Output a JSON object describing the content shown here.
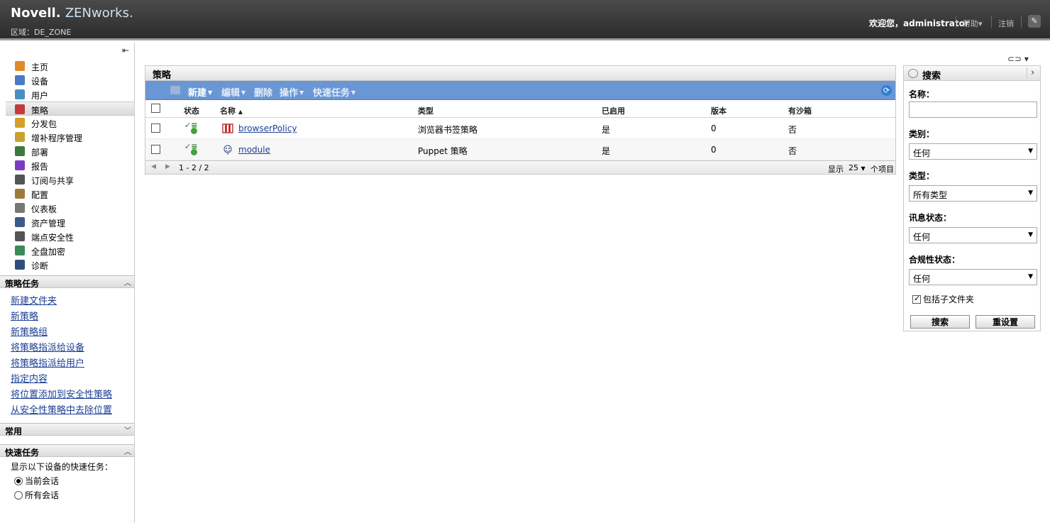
{
  "header": {
    "brand_novell": "Novell.",
    "brand_zen": "ZENworks.",
    "zone": "区域：DE_ZONE",
    "welcome": "欢迎您，administrator",
    "help": "帮助▾",
    "logout": "注销"
  },
  "nav": {
    "items": [
      {
        "label": "主页",
        "icon": "home-icon",
        "color": "#e08a2c"
      },
      {
        "label": "设备",
        "icon": "devices-icon",
        "color": "#4a7bc2"
      },
      {
        "label": "用户",
        "icon": "users-icon",
        "color": "#4a8fc2"
      },
      {
        "label": "策略",
        "icon": "policies-icon",
        "color": "#c23b3b"
      },
      {
        "label": "分发包",
        "icon": "bundles-icon",
        "color": "#d3a02a"
      },
      {
        "label": "增补程序管理",
        "icon": "patch-management-icon",
        "color": "#c9a131"
      },
      {
        "label": "部署",
        "icon": "deployment-icon",
        "color": "#3b7a3b"
      },
      {
        "label": "报告",
        "icon": "reports-icon",
        "color": "#7a3bc2"
      },
      {
        "label": "订阅与共享",
        "icon": "subscriptions-icon",
        "color": "#555555"
      },
      {
        "label": "配置",
        "icon": "configuration-icon",
        "color": "#a07a3b"
      },
      {
        "label": "仪表板",
        "icon": "dashboard-icon",
        "color": "#777777"
      },
      {
        "label": "资产管理",
        "icon": "asset-management-icon",
        "color": "#3b5a8a"
      },
      {
        "label": "端点安全性",
        "icon": "endpoint-security-icon",
        "color": "#555555"
      },
      {
        "label": "全盘加密",
        "icon": "full-disk-encryption-icon",
        "color": "#3b8a5a"
      },
      {
        "label": "诊断",
        "icon": "diagnostics-icon",
        "color": "#2f4f7a"
      }
    ],
    "active_index": 3
  },
  "policy_tasks": {
    "title": "策略任务",
    "links": [
      "新建文件夹",
      "新策略",
      "新策略组",
      "将策略指派给设备",
      "将策略指派给用户",
      "指定内容",
      "将位置添加到安全性策略",
      "从安全性策略中去除位置"
    ]
  },
  "common": {
    "title": "常用"
  },
  "quick_tasks": {
    "title": "快速任务",
    "text": "显示以下设备的快速任务：",
    "options": [
      "当前会话",
      "所有会话"
    ],
    "selected": 0
  },
  "main": {
    "title": "策略",
    "toolbar": {
      "new": "新建",
      "edit": "编辑",
      "delete": "删除",
      "actions": "操作",
      "quick_tasks": "快速任务"
    },
    "columns": [
      "状态",
      "名称",
      "类型",
      "已启用",
      "版本",
      "有沙箱"
    ],
    "rows": [
      {
        "name": "browserPolicy",
        "type": "浏览器书签策略",
        "enabled": "是",
        "version": "0",
        "sandbox": "否",
        "icon": "browser-bookmark-icon"
      },
      {
        "name": "module",
        "type": "Puppet 策略",
        "enabled": "是",
        "version": "0",
        "sandbox": "否",
        "icon": "puppet-policy-icon"
      }
    ],
    "pager": {
      "range": "1 - 2 / 2",
      "show_label": "显示",
      "page_size": "25",
      "items_label": "个项目"
    }
  },
  "search": {
    "title": "搜索",
    "name_label": "名称：",
    "name_value": "",
    "category_label": "类别：",
    "category_value": "任何",
    "type_label": "类型：",
    "type_value": "所有类型",
    "message_status_label": "讯息状态：",
    "message_status_value": "任何",
    "compliance_label": "合规性状态：",
    "compliance_value": "任何",
    "include_subfolders": "包括子文件夹",
    "search_button": "搜索",
    "reset_button": "重设置"
  }
}
